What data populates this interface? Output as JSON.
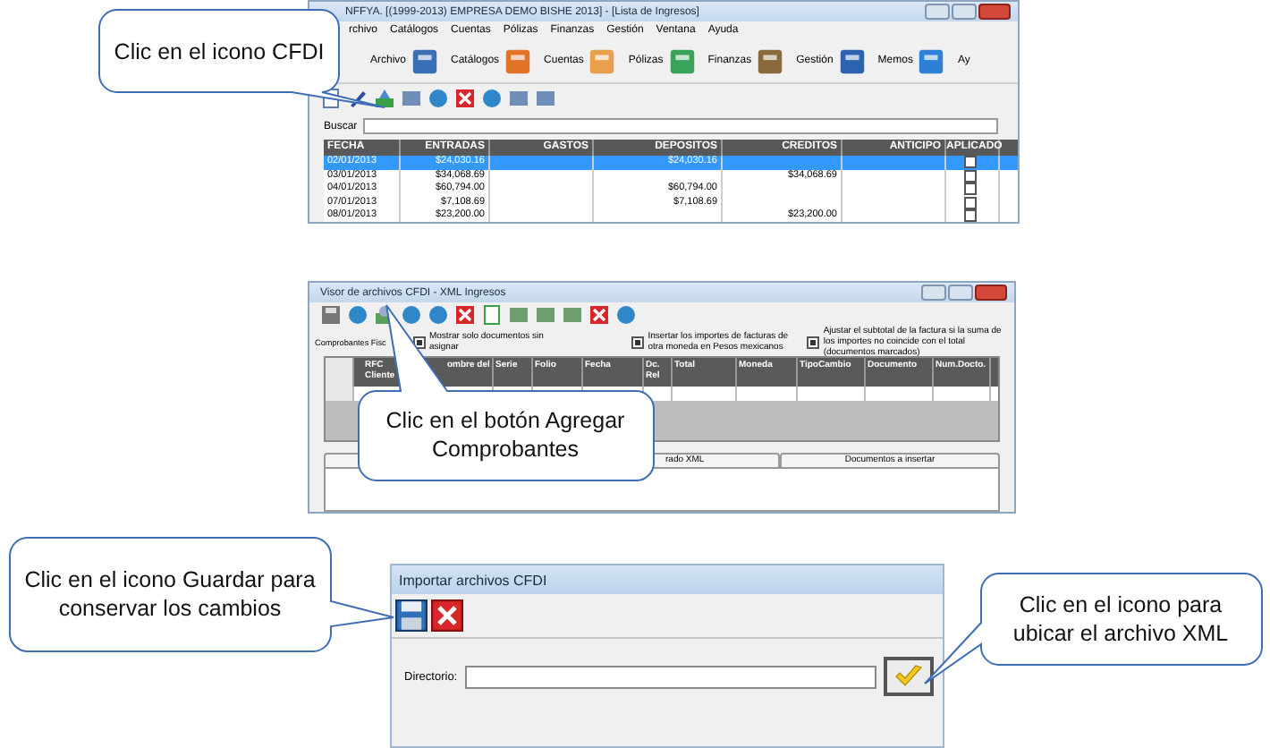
{
  "cfdi_window": {
    "title": "NFFYA. [(1999-2013) EMPRESA DEMO BISHE 2013]  - [Lista de Ingresos]",
    "menu": [
      "rchivo",
      "Catálogos",
      "Cuentas",
      "Pólizas",
      "Finanzas",
      "Gestión",
      "Ventana",
      "Ayuda"
    ],
    "toolbar": [
      "Archivo",
      "Catálogos",
      "Cuentas",
      "Pólizas",
      "Finanzas",
      "Gestión",
      "Memos",
      "Ay"
    ],
    "search_label": "Buscar",
    "table": {
      "columns": [
        "FECHA",
        "ENTRADAS",
        "GASTOS",
        "DEPOSITOS",
        "CREDITOS",
        "ANTICIPO",
        "APLICADO"
      ],
      "rows": [
        {
          "cells": [
            "02/01/2013",
            "$24,030.16",
            "",
            "$24,030.16",
            "",
            ""
          ],
          "aplicado": false,
          "selected": true
        },
        {
          "cells": [
            "03/01/2013",
            "$34,068.69",
            "",
            "",
            "$34,068.69",
            ""
          ],
          "aplicado": false,
          "selected": false
        },
        {
          "cells": [
            "04/01/2013",
            "$60,794.00",
            "",
            "$60,794.00",
            "",
            ""
          ],
          "aplicado": false,
          "selected": false
        },
        {
          "cells": [
            "07/01/2013",
            "$7,108.69",
            "",
            "$7,108.69",
            "",
            ""
          ],
          "aplicado": false,
          "selected": false
        },
        {
          "cells": [
            "08/01/2013",
            "$23,200.00",
            "",
            "",
            "$23,200.00",
            ""
          ],
          "aplicado": false,
          "selected": false
        }
      ]
    }
  },
  "xml_viewer": {
    "title": "Visor de archivos CFDI - XML Ingresos",
    "filter_label": "Comprobantes Fisc",
    "options": [
      {
        "label": "Mostrar solo documentos sin asignar",
        "checked": true
      },
      {
        "label": "Insertar los importes de facturas de otra moneda en Pesos mexicanos",
        "checked": true
      },
      {
        "label": "Ajustar el subtotal de la factura si la suma de los importes no coincide con el total (documentos marcados)",
        "checked": true
      }
    ],
    "grid_columns": [
      "RFC Cliente",
      "ombre del",
      "Serie",
      "Folio",
      "Fecha",
      "Dc. Rel",
      "Total",
      "Moneda",
      "TipoCambio",
      "Documento",
      "Num.Docto."
    ],
    "tabs": [
      "rado XML",
      "Documentos a insertar"
    ]
  },
  "import_window": {
    "title": "Importar archivos CFDI",
    "directory_label": "Directorio:"
  },
  "callouts": [
    "Clic en el icono CFDI",
    "Clic en el botón Agregar Comprobantes",
    "Clic en el icono Guardar para conservar los cambios",
    "Clic en el icono para ubicar el archivo XML"
  ]
}
